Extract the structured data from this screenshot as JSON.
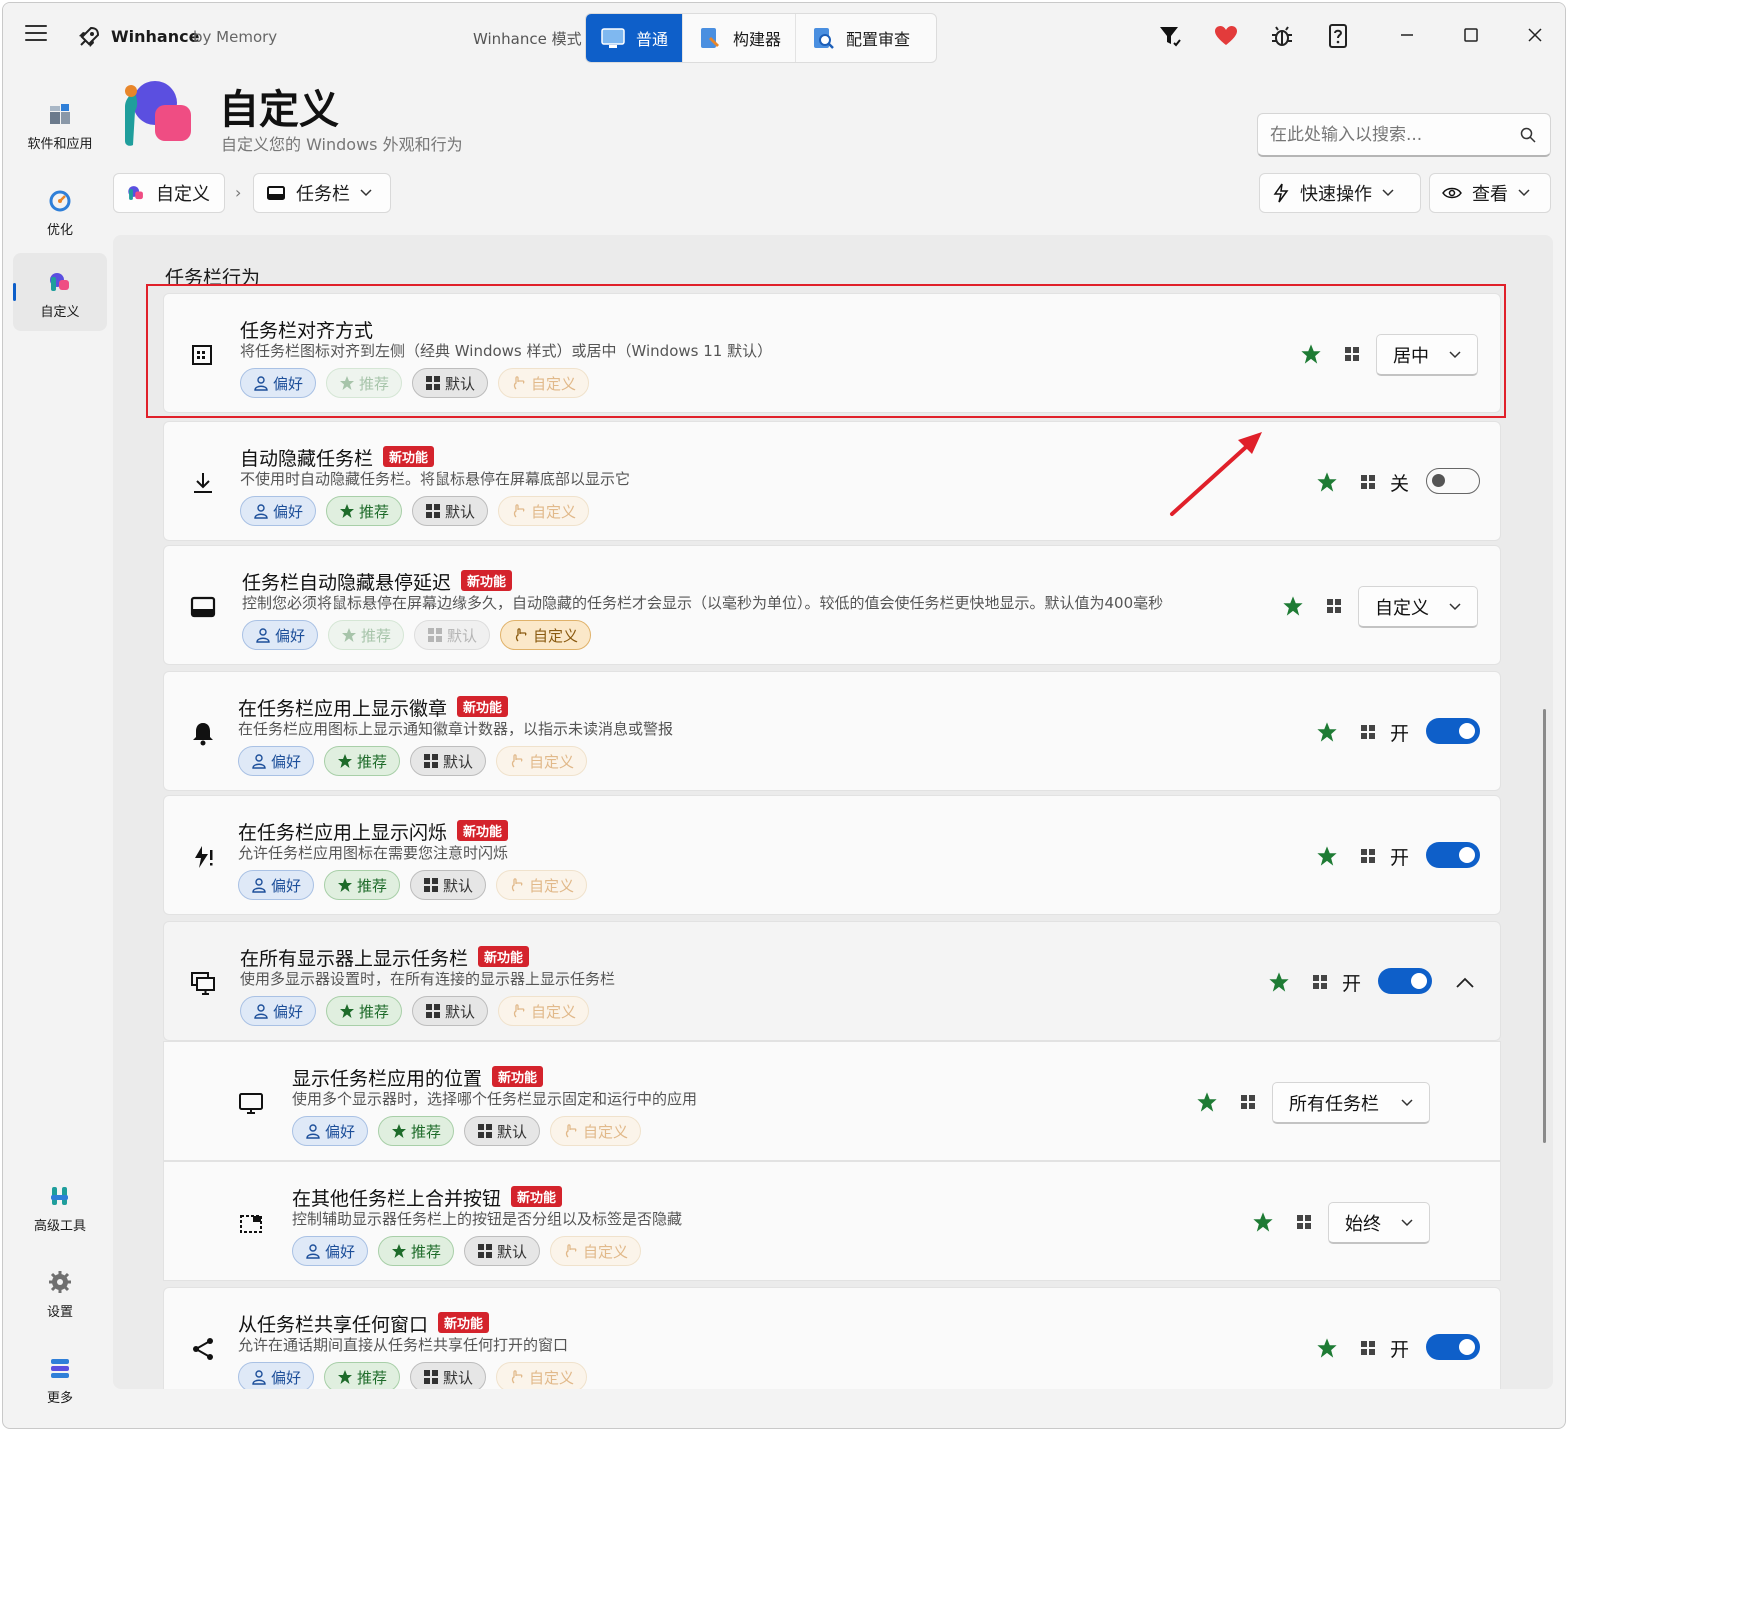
{
  "app": {
    "name": "Winhance",
    "by": "by Memory",
    "mode_label": "Winhance 模式",
    "modes": [
      {
        "label": "普通",
        "active": true
      },
      {
        "label": "构建器",
        "active": false
      },
      {
        "label": "配置审查",
        "active": false
      }
    ]
  },
  "nav": {
    "items": [
      {
        "label": "软件和应用"
      },
      {
        "label": "优化"
      },
      {
        "label": "自定义"
      },
      {
        "label": "高级工具"
      },
      {
        "label": "设置"
      },
      {
        "label": "更多"
      }
    ]
  },
  "header": {
    "title": "自定义",
    "subtitle": "自定义您的 Windows 外观和行为",
    "search_placeholder": "在此处输入以搜索..."
  },
  "breadcrumb": {
    "root": "自定义",
    "current": "任务栏"
  },
  "actions": {
    "quick": "快速操作",
    "view": "查看"
  },
  "section_title": "任务栏行为",
  "chip_labels": {
    "pref": "偏好",
    "rec": "推荐",
    "def": "默认",
    "cus": "自定义"
  },
  "new_badge": "新功能",
  "settings": [
    {
      "title": "任务栏对齐方式",
      "desc": "将任务栏图标对齐到左侧（经典 Windows 样式）或居中（Windows 11 默认）",
      "new": false,
      "control": "dropdown",
      "value": "居中",
      "icon": "align-icon"
    },
    {
      "title": "自动隐藏任务栏",
      "desc": "不使用时自动隐藏任务栏。将鼠标悬停在屏幕底部以显示它",
      "new": true,
      "control": "toggle",
      "value": "关",
      "on": false,
      "icon": "download-icon"
    },
    {
      "title": "任务栏自动隐藏悬停延迟",
      "desc": "控制您必须将鼠标悬停在屏幕边缘多久，自动隐藏的任务栏才会显示（以毫秒为单位）。较低的值会使任务栏更快地显示。默认值为400毫秒",
      "new": true,
      "control": "dropdown",
      "value": "自定义",
      "icon": "taskbar-icon"
    },
    {
      "title": "在任务栏应用上显示徽章",
      "desc": "在任务栏应用图标上显示通知徽章计数器，以指示未读消息或警报",
      "new": true,
      "control": "toggle",
      "value": "开",
      "on": true,
      "icon": "bell-icon"
    },
    {
      "title": "在任务栏应用上显示闪烁",
      "desc": "允许任务栏应用图标在需要您注意时闪烁",
      "new": true,
      "control": "toggle",
      "value": "开",
      "on": true,
      "icon": "flash-icon"
    },
    {
      "title": "在所有显示器上显示任务栏",
      "desc": "使用多显示器设置时，在所有连接的显示器上显示任务栏",
      "new": true,
      "control": "toggle",
      "value": "开",
      "on": true,
      "icon": "monitors-icon"
    },
    {
      "title": "显示任务栏应用的位置",
      "desc": "使用多个显示器时，选择哪个任务栏显示固定和运行中的应用",
      "new": true,
      "control": "dropdown",
      "value": "所有任务栏",
      "icon": "monitor-icon"
    },
    {
      "title": "在其他任务栏上合并按钮",
      "desc": "控制辅助显示器任务栏上的按钮是否分组以及标签是否隐藏",
      "new": true,
      "control": "dropdown",
      "value": "始终",
      "icon": "combine-icon"
    },
    {
      "title": "从任务栏共享任何窗口",
      "desc": "允许在通话期间直接从任务栏共享任何打开的窗口",
      "new": true,
      "control": "toggle",
      "value": "开",
      "on": true,
      "icon": "share-icon"
    }
  ],
  "colors": {
    "accent": "#0e5fc9",
    "star": "#1e7b34",
    "badge": "#d4232c",
    "highlight": "#e0202a"
  }
}
